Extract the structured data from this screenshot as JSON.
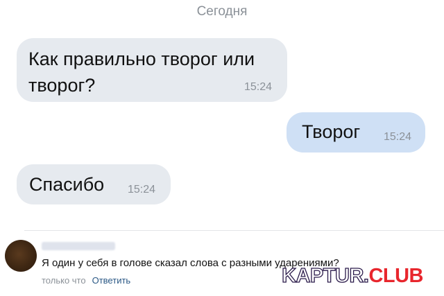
{
  "chat": {
    "date_separator": "Сегодня",
    "messages": [
      {
        "direction": "incoming",
        "text": "Как правильно творог или творог?",
        "time": "15:24"
      },
      {
        "direction": "outgoing",
        "text": "Творог",
        "time": "15:24"
      },
      {
        "direction": "incoming",
        "text": "Спасибо",
        "time": "15:24"
      }
    ]
  },
  "comment": {
    "text": "Я один у себя в голове сказал слова с разными ударениями?",
    "timestamp": "только что",
    "reply_label": "Ответить"
  },
  "watermark": {
    "part1": "KAPTUR.",
    "part2": "CLUB"
  },
  "colors": {
    "incoming_bubble": "#e6eaef",
    "outgoing_bubble": "#cfe0f5",
    "link": "#2a5885",
    "watermark_accent": "#e8262d"
  }
}
